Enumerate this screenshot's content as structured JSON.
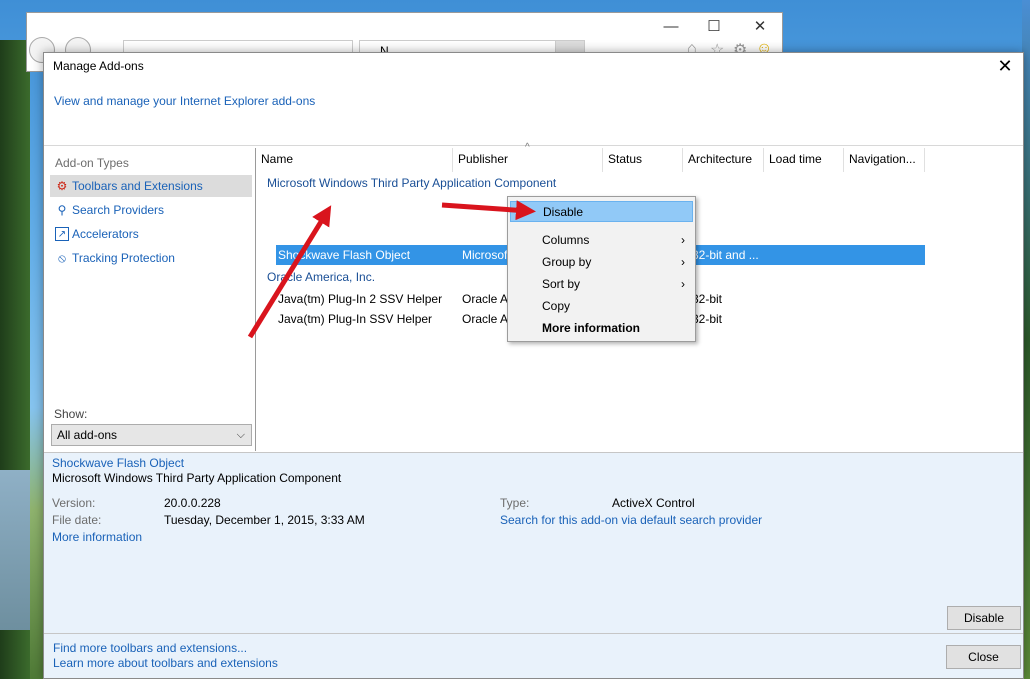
{
  "dialog": {
    "title": "Manage Add-ons",
    "header_link": "View and manage your Internet Explorer add-ons"
  },
  "left_panel": {
    "heading": "Add-on Types",
    "items": [
      {
        "label": "Toolbars and Extensions",
        "icon": "gear-block-icon",
        "selected": true
      },
      {
        "label": "Search Providers",
        "icon": "search-icon",
        "selected": false
      },
      {
        "label": "Accelerators",
        "icon": "accelerator-icon",
        "selected": false
      },
      {
        "label": "Tracking Protection",
        "icon": "no-entry-icon",
        "selected": false
      }
    ],
    "show_label": "Show:",
    "show_value": "All add-ons"
  },
  "list": {
    "columns": [
      "Name",
      "Publisher",
      "Status",
      "Architecture",
      "Load time",
      "Navigation..."
    ],
    "groups": [
      {
        "header": "Microsoft Windows Third Party Application Component",
        "rows": [
          {
            "name": "Shockwave Flash Object",
            "publisher": "Microsof",
            "arch": "32-bit and ...",
            "selected": true
          }
        ]
      },
      {
        "header": "Oracle America, Inc.",
        "rows": [
          {
            "name": "Java(tm) Plug-In 2 SSV Helper",
            "publisher": "Oracle A",
            "arch": "32-bit",
            "selected": false
          },
          {
            "name": "Java(tm) Plug-In SSV Helper",
            "publisher": "Oracle A",
            "arch": "32-bit",
            "selected": false
          }
        ]
      }
    ]
  },
  "context_menu": {
    "items": [
      "Disable",
      "Columns",
      "Group by",
      "Sort by",
      "Copy",
      "More information"
    ]
  },
  "details": {
    "name": "Shockwave Flash Object",
    "publisher": "Microsoft Windows Third Party Application Component",
    "version_label": "Version:",
    "version": "20.0.0.228",
    "file_date_label": "File date:",
    "file_date": "Tuesday, December 1, 2015, 3:33 AM",
    "more_info": "More information",
    "type_label": "Type:",
    "type": "ActiveX Control",
    "search_link": "Search for this add-on via default search provider",
    "disable_button": "Disable"
  },
  "footer": {
    "find_link": "Find more toolbars and extensions...",
    "learn_link": "Learn more about toolbars and extensions",
    "close_button": "Close"
  },
  "browser": {
    "tab_title": "N..."
  },
  "colors": {
    "link": "#1a62b8",
    "selection": "#3394e6",
    "menu_highlight": "#91c9f7",
    "annotation_arrow": "#d9141d"
  }
}
